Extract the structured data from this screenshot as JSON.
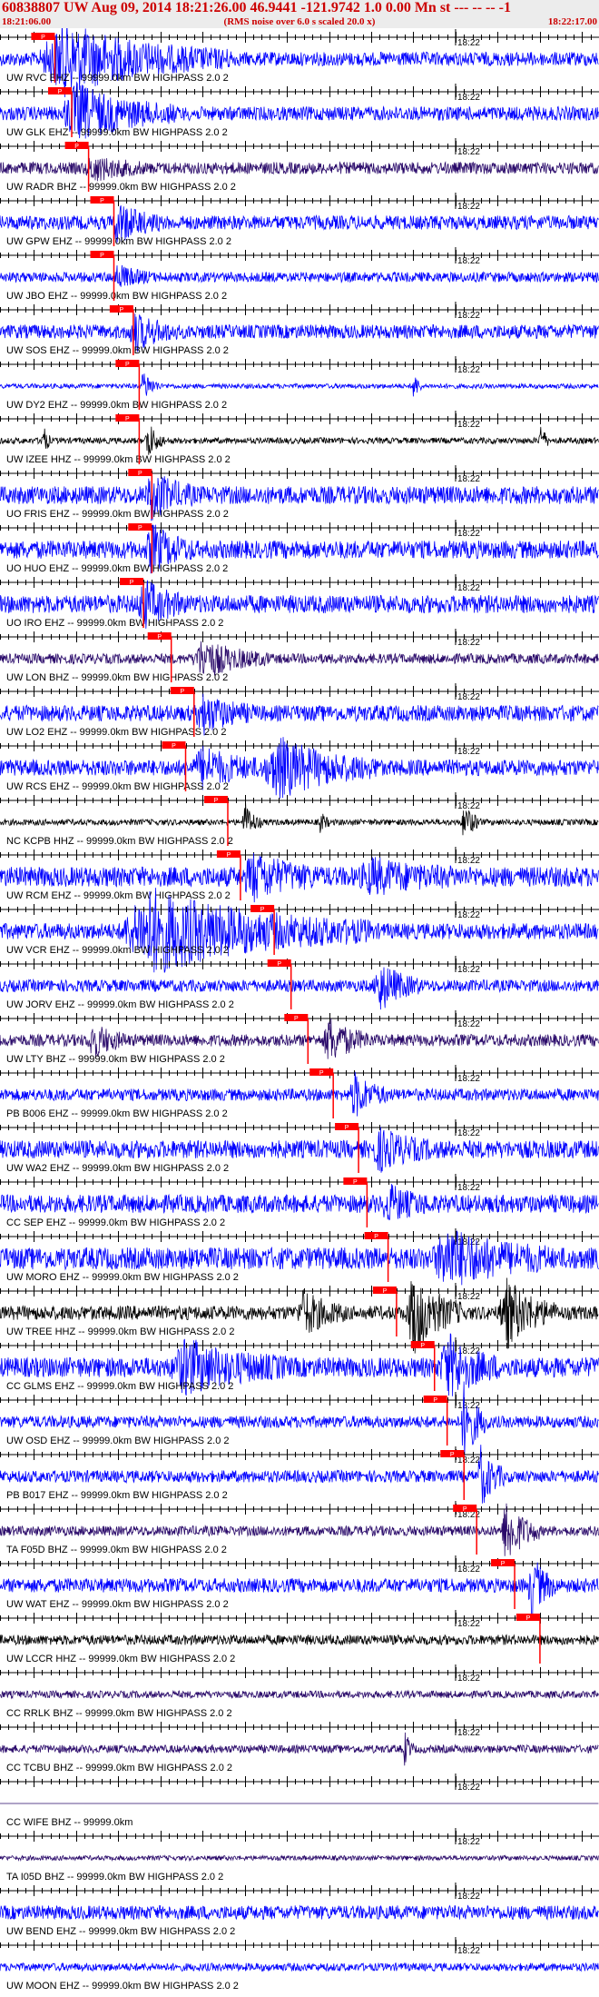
{
  "header": {
    "title": "60838807 UW Aug 09, 2014 18:21:26.00   46.9441 -121.9742  1.0 0.00 Mn st --- -- --   -1",
    "start_time": "18:21:06.00",
    "subtitle": "(RMS noise over 6.0 s scaled 20.0 x)",
    "end_time": "18:22:17.00"
  },
  "chart_data": {
    "type": "seismogram",
    "time_axis": {
      "start": "18:21:06.00",
      "end": "18:22:17.00",
      "minute_mark": "18:22",
      "minute_mark_seconds": 54
    },
    "pick_label": "P",
    "colors": {
      "pick": "#ff0000",
      "tick": "#000000",
      "trace_blue": "#0000ff",
      "trace_black": "#000000",
      "trace_purple": "#2a0a6a"
    },
    "traces": [
      {
        "label": "UW RVC EHZ -- 99999.0km BW  HIGHPASS  2.0  2",
        "color": "#0000ff",
        "pick_s": 6.5,
        "amp": 0.35,
        "bursts": [
          [
            7.5,
            20,
            1.6
          ]
        ]
      },
      {
        "label": "UW GLK EHZ -- 99999.0km BW  HIGHPASS  2.0  2",
        "color": "#0000ff",
        "pick_s": 8.5,
        "amp": 0.35,
        "bursts": [
          [
            9,
            12,
            1.3
          ]
        ]
      },
      {
        "label": "UW RADR BHZ -- 99999.0km BW  HIGHPASS  2.0  2",
        "color": "#2a0a6a",
        "pick_s": 10.5,
        "amp": 0.3,
        "bursts": [
          [
            11,
            6,
            0.5
          ]
        ]
      },
      {
        "label": "UW GPW EHZ -- 99999.0km BW  HIGHPASS  2.0  2",
        "color": "#0000ff",
        "pick_s": 13.5,
        "amp": 0.35,
        "bursts": [
          [
            14,
            5,
            0.9
          ]
        ]
      },
      {
        "label": "UW JBO EHZ -- 99999.0km BW  HIGHPASS  2.0  2",
        "color": "#0000ff",
        "pick_s": 13.5,
        "amp": 0.25,
        "bursts": [
          [
            14,
            4,
            0.5
          ]
        ]
      },
      {
        "label": "UW SOS EHZ -- 99999.0km BW  HIGHPASS  2.0  2",
        "color": "#0000ff",
        "pick_s": 15.8,
        "amp": 0.35,
        "bursts": [
          [
            16,
            5,
            0.8
          ]
        ]
      },
      {
        "label": "UW DY2 EHZ -- 99999.0km BW  HIGHPASS  2.0  2",
        "color": "#0000ff",
        "pick_s": 16.5,
        "amp": 0.12,
        "bursts": [
          [
            17,
            2,
            0.8
          ],
          [
            49,
            1,
            0.8
          ]
        ]
      },
      {
        "label": "UW IZEE HHZ -- 99999.0km BW  HIGHPASS  2.0  2",
        "color": "#000000",
        "pick_s": 16.5,
        "amp": 0.15,
        "bursts": [
          [
            5,
            1,
            1.0
          ],
          [
            17.5,
            2,
            1.0
          ],
          [
            64,
            1,
            1.0
          ]
        ]
      },
      {
        "label": "UO FRIS EHZ -- 99999.0km BW  HIGHPASS  2.0  2",
        "color": "#0000ff",
        "pick_s": 18,
        "amp": 0.45,
        "bursts": [
          [
            18,
            5,
            1.0
          ]
        ]
      },
      {
        "label": "UO HUO EHZ -- 99999.0km BW  HIGHPASS  2.0  2",
        "color": "#0000ff",
        "pick_s": 18,
        "amp": 0.45,
        "bursts": [
          [
            18,
            5,
            1.0
          ]
        ]
      },
      {
        "label": "UO IRO EHZ -- 99999.0km BW  HIGHPASS  2.0  2",
        "color": "#0000ff",
        "pick_s": 17,
        "amp": 0.45,
        "bursts": [
          [
            17,
            5,
            1.0
          ]
        ]
      },
      {
        "label": "UW LON BHZ -- 99999.0km BW  HIGHPASS  2.0  2",
        "color": "#2a0a6a",
        "pick_s": 20.3,
        "amp": 0.25,
        "bursts": [
          [
            24,
            8,
            0.9
          ]
        ]
      },
      {
        "label": "UW LO2 EHZ -- 99999.0km BW  HIGHPASS  2.0  2",
        "color": "#0000ff",
        "pick_s": 23,
        "amp": 0.4,
        "bursts": [
          [
            24,
            6,
            0.8
          ]
        ]
      },
      {
        "label": "UW RCS EHZ -- 99999.0km BW  HIGHPASS  2.0  2",
        "color": "#0000ff",
        "pick_s": 22,
        "amp": 0.4,
        "bursts": [
          [
            24,
            8,
            0.8
          ],
          [
            33,
            12,
            1.3
          ]
        ]
      },
      {
        "label": "NC KCPB HHZ -- 99999.0km BW  HIGHPASS  2.0  2",
        "color": "#000000",
        "pick_s": 27,
        "amp": 0.15,
        "bursts": [
          [
            29,
            2,
            1.0
          ],
          [
            38,
            1,
            0.6
          ],
          [
            55,
            2,
            1.0
          ]
        ]
      },
      {
        "label": "UW RCM EHZ -- 99999.0km BW  HIGHPASS  2.0  2",
        "color": "#0000ff",
        "pick_s": 28.5,
        "amp": 0.5,
        "bursts": [
          [
            30,
            8,
            0.9
          ],
          [
            44,
            10,
            0.6
          ]
        ]
      },
      {
        "label": "UW VCR EHZ -- 99999.0km BW  HIGHPASS  2.0  2",
        "color": "#0000ff",
        "pick_s": 32.5,
        "amp": 0.4,
        "bursts": [
          [
            18,
            26,
            1.9
          ]
        ]
      },
      {
        "label": "UW JORV EHZ -- 99999.0km BW  HIGHPASS  2.0  2",
        "color": "#0000ff",
        "pick_s": 34.5,
        "amp": 0.3,
        "bursts": [
          [
            45,
            5,
            1.1
          ]
        ]
      },
      {
        "label": "UW LTY BHZ -- 99999.0km BW  HIGHPASS  2.0  2",
        "color": "#2a0a6a",
        "pick_s": 36.5,
        "amp": 0.3,
        "bursts": [
          [
            11,
            4,
            0.8
          ],
          [
            39,
            5,
            1.0
          ]
        ]
      },
      {
        "label": "PB B006 EHZ -- 99999.0km BW  HIGHPASS  2.0  2",
        "color": "#0000ff",
        "pick_s": 39.5,
        "amp": 0.3,
        "bursts": [
          [
            42,
            4,
            1.0
          ]
        ]
      },
      {
        "label": "UW WA2 EHZ -- 99999.0km BW  HIGHPASS  2.0  2",
        "color": "#0000ff",
        "pick_s": 42.5,
        "amp": 0.45,
        "bursts": [
          [
            45,
            6,
            0.8
          ]
        ]
      },
      {
        "label": "CC SEP EHZ -- 99999.0km BW  HIGHPASS  2.0  2",
        "color": "#0000ff",
        "pick_s": 43.5,
        "amp": 0.45,
        "bursts": [
          [
            46,
            5,
            0.7
          ]
        ]
      },
      {
        "label": "UW MORO EHZ -- 99999.0km BW  HIGHPASS  2.0  2",
        "color": "#0000ff",
        "pick_s": 46,
        "amp": 0.55,
        "bursts": [
          [
            53,
            12,
            1.2
          ]
        ]
      },
      {
        "label": "UW TREE HHZ -- 99999.0km BW  HIGHPASS  2.0  2",
        "color": "#000000",
        "pick_s": 47,
        "amp": 0.35,
        "bursts": [
          [
            36,
            5,
            1.0
          ],
          [
            49,
            6,
            1.9
          ],
          [
            60,
            6,
            1.6
          ]
        ]
      },
      {
        "label": "CC GLMS EHZ -- 99999.0km BW  HIGHPASS  2.0  2",
        "color": "#0000ff",
        "pick_s": 51.5,
        "amp": 0.5,
        "bursts": [
          [
            22,
            12,
            1.1
          ],
          [
            53,
            6,
            1.4
          ]
        ]
      },
      {
        "label": "UW OSD EHZ -- 99999.0km BW  HIGHPASS  2.0  2",
        "color": "#0000ff",
        "pick_s": 53,
        "amp": 0.3,
        "bursts": [
          [
            55,
            3,
            1.8
          ]
        ]
      },
      {
        "label": "PB B017 EHZ -- 99999.0km BW  HIGHPASS  2.0  2",
        "color": "#0000ff",
        "pick_s": 55,
        "amp": 0.3,
        "bursts": [
          [
            57,
            3,
            1.4
          ]
        ]
      },
      {
        "label": "TA F05D BHZ -- 99999.0km BW  HIGHPASS  2.0  2",
        "color": "#2a0a6a",
        "pick_s": 56.5,
        "amp": 0.25,
        "bursts": [
          [
            60,
            4,
            1.6
          ]
        ]
      },
      {
        "label": "UW WAT EHZ -- 99999.0km BW  HIGHPASS  2.0  2",
        "color": "#0000ff",
        "pick_s": 61,
        "amp": 0.35,
        "bursts": [
          [
            63,
            3,
            1.4
          ]
        ]
      },
      {
        "label": "UW LCCR HHZ -- 99999.0km BW  HIGHPASS  2.0  2",
        "color": "#000000",
        "pick_s": 64,
        "amp": 0.25,
        "bursts": []
      },
      {
        "label": "CC RRLK BHZ -- 99999.0km BW  HIGHPASS  2.0  2",
        "color": "#2a0a6a",
        "pick_s": null,
        "amp": 0.18,
        "bursts": []
      },
      {
        "label": "CC TCBU BHZ -- 99999.0km BW  HIGHPASS  2.0  2",
        "color": "#2a0a6a",
        "pick_s": null,
        "amp": 0.2,
        "bursts": [
          [
            48,
            1,
            0.9
          ]
        ]
      },
      {
        "label": "CC WIFE BHZ -- 99999.0km",
        "color": "#2a0a6a",
        "pick_s": null,
        "amp": 0.0,
        "bursts": []
      },
      {
        "label": "TA I05D BHZ -- 99999.0km BW  HIGHPASS  2.0  2",
        "color": "#2a0a6a",
        "pick_s": null,
        "amp": 0.12,
        "bursts": []
      },
      {
        "label": "UW BEND EHZ -- 99999.0km BW  HIGHPASS  2.0  2",
        "color": "#0000ff",
        "pick_s": null,
        "amp": 0.35,
        "bursts": []
      },
      {
        "label": "UW MOON EHZ -- 99999.0km BW  HIGHPASS  2.0  2",
        "color": "#0000ff",
        "pick_s": null,
        "amp": 0.2,
        "bursts": []
      }
    ]
  }
}
